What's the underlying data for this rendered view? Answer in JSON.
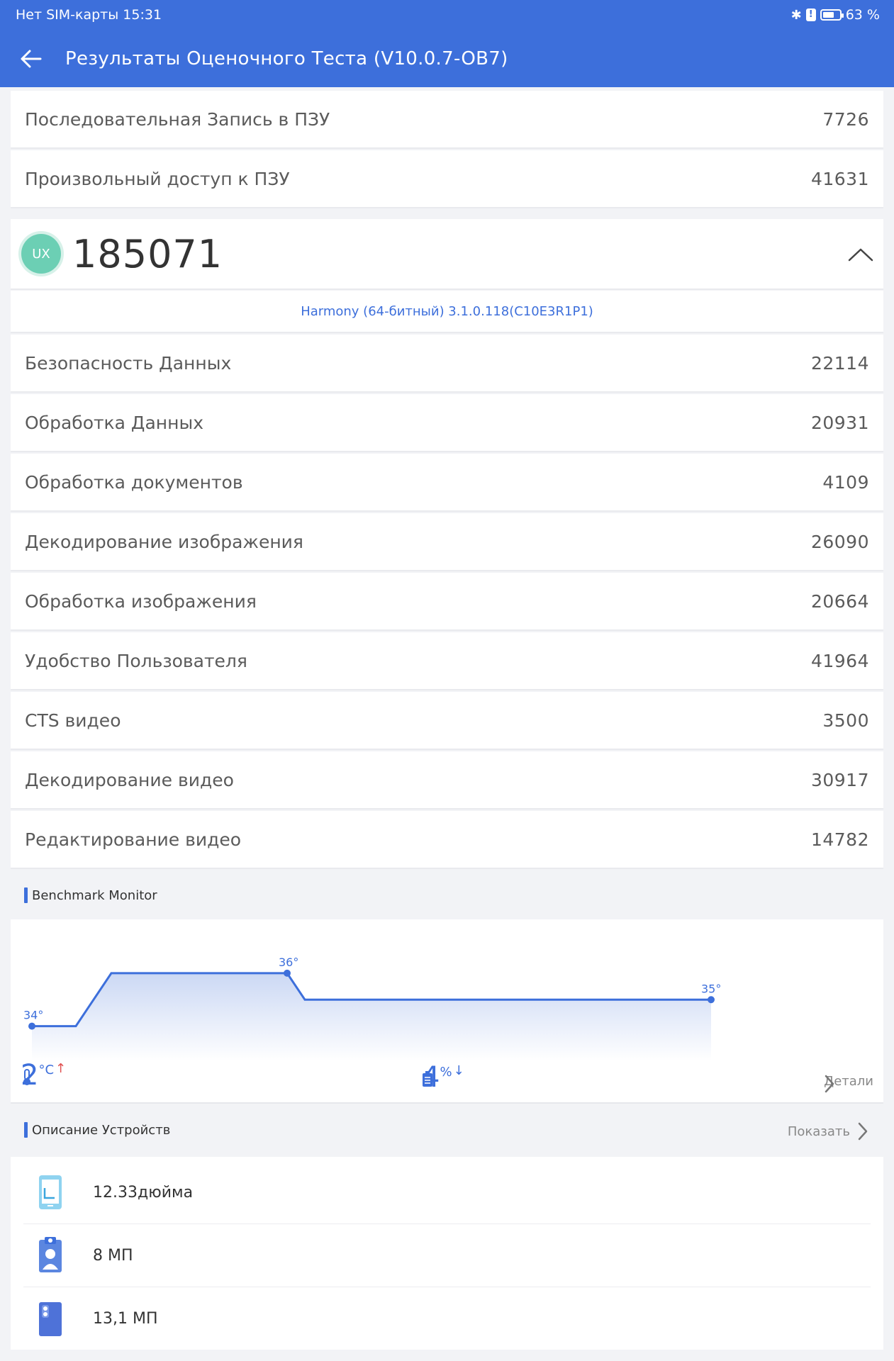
{
  "status": {
    "left": "Нет SIM-карты 15:31",
    "battery": "63 %"
  },
  "header": {
    "title": "Результаты Оценочного Теста (V10.0.7-OB7)"
  },
  "rom_rows": [
    {
      "label": "Последовательная Запись в ПЗУ",
      "value": "7726"
    },
    {
      "label": "Произвольный доступ к ПЗУ",
      "value": "41631"
    }
  ],
  "ux": {
    "badge": "UX",
    "score": "185071",
    "os": "Harmony (64-битный) 3.1.0.118(C10E3R1P1)",
    "rows": [
      {
        "label": "Безопасность Данных",
        "value": "22114"
      },
      {
        "label": "Обработка Данных",
        "value": "20931"
      },
      {
        "label": "Обработка документов",
        "value": "4109"
      },
      {
        "label": "Декодирование изображения",
        "value": "26090"
      },
      {
        "label": "Обработка изображения",
        "value": "20664"
      },
      {
        "label": "Удобство Пользователя",
        "value": "41964"
      },
      {
        "label": "CTS видео",
        "value": "3500"
      },
      {
        "label": "Декодирование видео",
        "value": "30917"
      },
      {
        "label": "Редактирование видео",
        "value": "14782"
      }
    ]
  },
  "monitor": {
    "title": "Benchmark Monitor",
    "temp_change": "2",
    "temp_unit": "°C",
    "temp_arrow": "↑",
    "battery_change": "4",
    "battery_unit": "%",
    "battery_arrow": "↓",
    "details_label": "Детали",
    "chart_data": {
      "type": "line",
      "series": [
        {
          "values": [
            34,
            34,
            36,
            36,
            35,
            35
          ]
        }
      ],
      "point_labels": [
        "34°",
        "36°",
        "35°"
      ],
      "ylim": [
        33,
        37
      ]
    }
  },
  "devices": {
    "title": "Описание Устройств",
    "show_label": "Показать",
    "items": [
      {
        "icon": "tablet-screen-icon",
        "text": "12.33дюйма"
      },
      {
        "icon": "front-camera-icon",
        "text": "8 МП"
      },
      {
        "icon": "rear-camera-icon",
        "text": "13,1 МП"
      }
    ]
  },
  "colors": {
    "accent": "#3d6fdb",
    "ux_badge": "#6ccfb4"
  }
}
